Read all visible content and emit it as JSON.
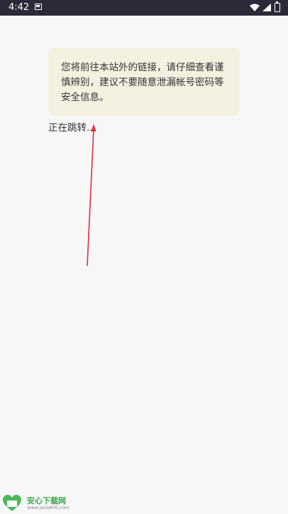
{
  "status_bar": {
    "time": "4:42",
    "icons": [
      "notification-icon",
      "wifi-icon",
      "signal-icon",
      "battery-icon"
    ]
  },
  "notice": {
    "message": "您将前往本站外的链接，请仔细查看谨慎辨别，建议不要随意泄漏帐号密码等安全信息。"
  },
  "redirect": {
    "status_text": "正在跳转..."
  },
  "watermark": {
    "title": "安心下载网",
    "url": "www.java800.com",
    "badge_text": "安心"
  },
  "colors": {
    "status_bar_bg": "#2a2a38",
    "page_bg": "#f7f7f7",
    "notice_bg": "#f5f1e1",
    "text": "#333333",
    "annotation_arrow": "#e0303c",
    "logo_green": "#3aa64a"
  }
}
